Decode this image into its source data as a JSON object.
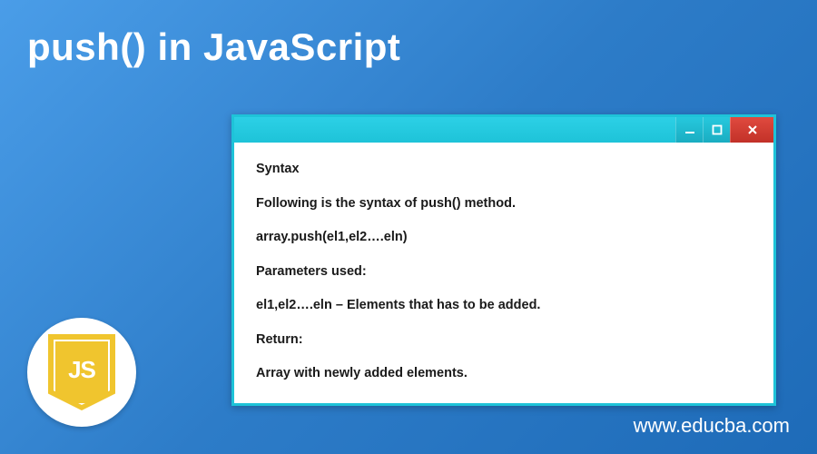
{
  "title": "push() in JavaScript",
  "window": {
    "lines": [
      "Syntax",
      "Following is the syntax of push() method.",
      "array.push(el1,el2….eln)",
      "Parameters used:",
      "el1,el2….eln – Elements that has to be added.",
      "Return:",
      "Array with newly added elements."
    ]
  },
  "logo": {
    "text": "JS"
  },
  "footer": {
    "url": "www.educba.com"
  }
}
